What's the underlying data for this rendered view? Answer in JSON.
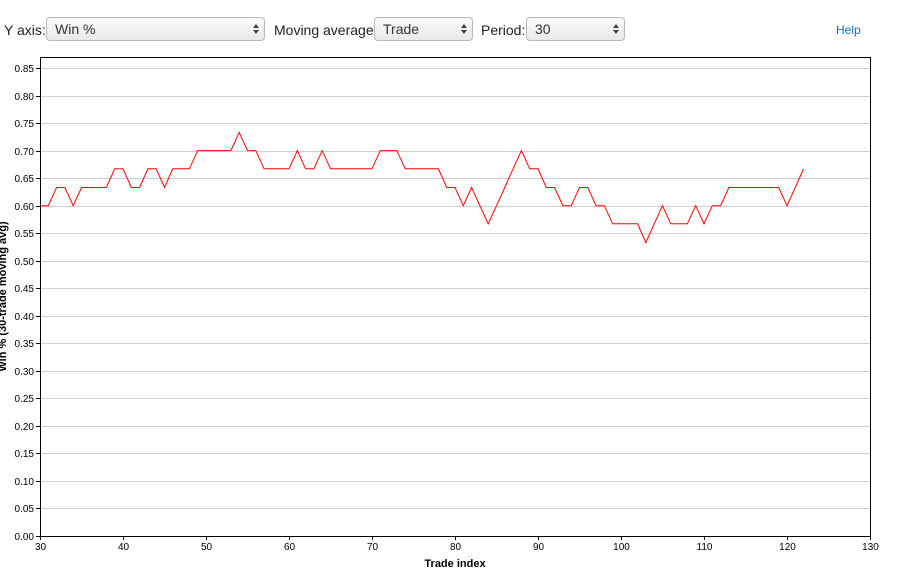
{
  "toolbar": {
    "y_axis_label": "Y axis:",
    "y_axis_value": "Win %",
    "moving_avg_label": "Moving average:",
    "moving_avg_value": "Trade",
    "period_label": "Period:",
    "period_value": "30",
    "help_label": "Help"
  },
  "chart_data": {
    "type": "line",
    "xlabel": "Trade index",
    "ylabel": "Win % (30-trade moving avg)",
    "xlim": [
      30,
      130
    ],
    "ylim": [
      0,
      0.87
    ],
    "x_ticks": [
      30,
      40,
      50,
      60,
      70,
      80,
      90,
      100,
      110,
      120,
      130
    ],
    "y_ticks": [
      0,
      0.05,
      0.1,
      0.15,
      0.2,
      0.25,
      0.3,
      0.35,
      0.4,
      0.45,
      0.5,
      0.55,
      0.6,
      0.65,
      0.7,
      0.75,
      0.8,
      0.85
    ],
    "grid": "horizontal",
    "line_color": "#ff0000",
    "series": [
      {
        "x": [
          30,
          31,
          32,
          33,
          34,
          35,
          36,
          37,
          38,
          39,
          40,
          41,
          42,
          43,
          44,
          45,
          46,
          47,
          48,
          49,
          50,
          51,
          52,
          53,
          54,
          55,
          56,
          57,
          58,
          59,
          60,
          61,
          62,
          63,
          64,
          65,
          66,
          67,
          68,
          69,
          70,
          71,
          72,
          73,
          74,
          75,
          76,
          77,
          78,
          79,
          80,
          81,
          82,
          83,
          84,
          85,
          86,
          87,
          88,
          89,
          90,
          91,
          92,
          93,
          94,
          95,
          96,
          97,
          98,
          99,
          100,
          101,
          102,
          103,
          104,
          105,
          106,
          107,
          108,
          109,
          110,
          111,
          112,
          113,
          114,
          115,
          116,
          117,
          118,
          119,
          120,
          121,
          122
        ],
        "y": [
          0.6,
          0.6,
          0.633,
          0.633,
          0.6,
          0.633,
          0.633,
          0.633,
          0.633,
          0.667,
          0.667,
          0.633,
          0.633,
          0.667,
          0.667,
          0.633,
          0.667,
          0.667,
          0.667,
          0.7,
          0.7,
          0.7,
          0.7,
          0.7,
          0.733,
          0.7,
          0.7,
          0.667,
          0.667,
          0.667,
          0.667,
          0.7,
          0.667,
          0.667,
          0.7,
          0.667,
          0.667,
          0.667,
          0.667,
          0.667,
          0.667,
          0.7,
          0.7,
          0.7,
          0.667,
          0.667,
          0.667,
          0.667,
          0.667,
          0.633,
          0.633,
          0.6,
          0.633,
          0.6,
          0.567,
          0.6,
          0.633,
          0.667,
          0.7,
          0.667,
          0.667,
          0.633,
          0.633,
          0.6,
          0.6,
          0.633,
          0.633,
          0.6,
          0.6,
          0.567,
          0.567,
          0.567,
          0.567,
          0.533,
          0.567,
          0.6,
          0.567,
          0.567,
          0.567,
          0.6,
          0.567,
          0.6,
          0.6,
          0.633,
          0.633,
          0.633,
          0.633,
          0.633,
          0.633,
          0.633,
          0.6,
          0.633,
          0.667
        ]
      }
    ]
  }
}
